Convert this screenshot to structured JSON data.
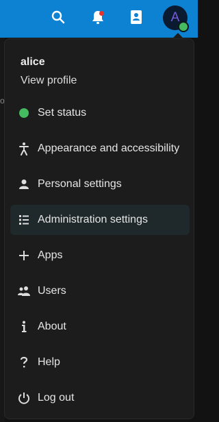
{
  "header": {
    "icons": [
      "search-icon",
      "bell-icon",
      "contacts-icon"
    ],
    "avatar_letter": "A",
    "notification_color": "#e9322d",
    "accent": "#0d81d2",
    "status_color": "#46ba61"
  },
  "menu": {
    "user_name": "alice",
    "view_profile": "View profile",
    "items": [
      {
        "label": "Set status",
        "icon": "online-status-icon"
      },
      {
        "label": "Appearance and accessibility",
        "icon": "accessibility-icon"
      },
      {
        "label": "Personal settings",
        "icon": "person-icon"
      },
      {
        "label": "Administration settings",
        "icon": "admin-list-icon"
      },
      {
        "label": "Apps",
        "icon": "plus-icon"
      },
      {
        "label": "Users",
        "icon": "users-icon"
      },
      {
        "label": "About",
        "icon": "info-icon"
      },
      {
        "label": "Help",
        "icon": "help-icon"
      },
      {
        "label": "Log out",
        "icon": "power-icon"
      }
    ]
  }
}
